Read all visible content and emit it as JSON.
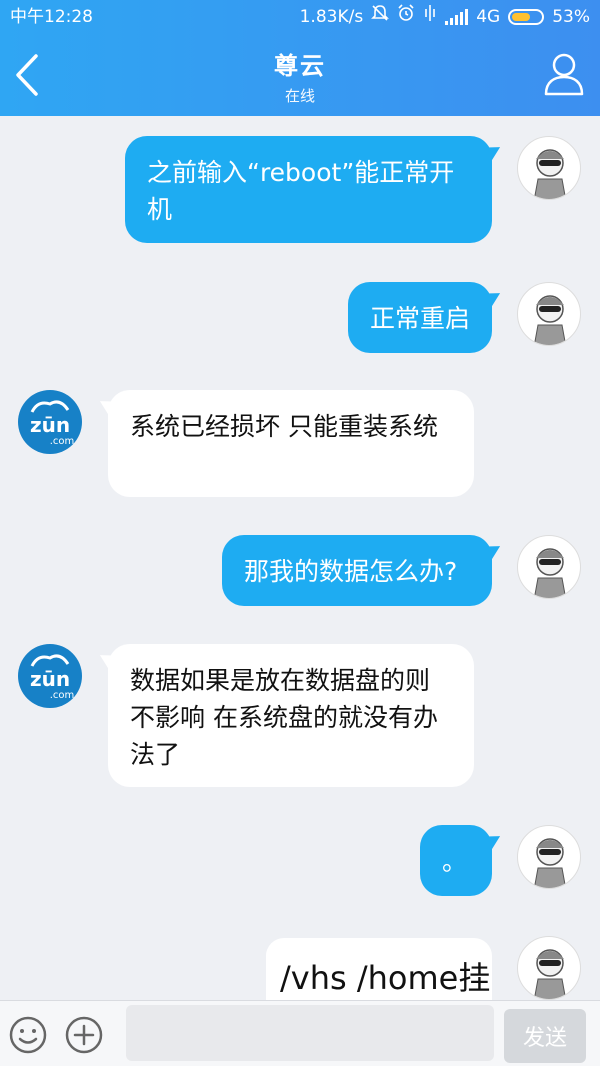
{
  "status_bar": {
    "time": "中午12:28",
    "net_speed": "1.83K/s",
    "network": "4G",
    "battery": "53%"
  },
  "header": {
    "title": "尊云",
    "subtitle": "在线"
  },
  "messages": [
    {
      "from": "me",
      "text": "之前输入“reboot”能正常开机"
    },
    {
      "from": "me",
      "text": "正常重启"
    },
    {
      "from": "other",
      "text": "系统已经损坏  只能重装系统"
    },
    {
      "from": "me",
      "text": "那我的数据怎么办?"
    },
    {
      "from": "other",
      "text": "数据如果是放在数据盘的则不影响 在系统盘的就没有办法了"
    },
    {
      "from": "me",
      "text": "。"
    },
    {
      "from": "me",
      "text": "/vhs   /home挂"
    }
  ],
  "avatars": {
    "other_logo_text": "zūn",
    "other_logo_sub": ".com"
  },
  "input_bar": {
    "placeholder": "",
    "send_label": "发送"
  },
  "colors": {
    "header_start": "#2fa6f3",
    "header_end": "#3d8ff0",
    "bubble_me": "#1eacf2",
    "bubble_other": "#ffffff",
    "background": "#eef0f4",
    "battery_fill": "#ffc130"
  },
  "icons": {
    "back": "chevron-left-icon",
    "profile": "person-icon",
    "emoji": "smiley-icon",
    "plus": "plus-circle-icon",
    "mute": "bell-mute-icon",
    "alarm": "alarm-icon",
    "vibrate": "vibrate-icon",
    "signal": "signal-icon"
  }
}
